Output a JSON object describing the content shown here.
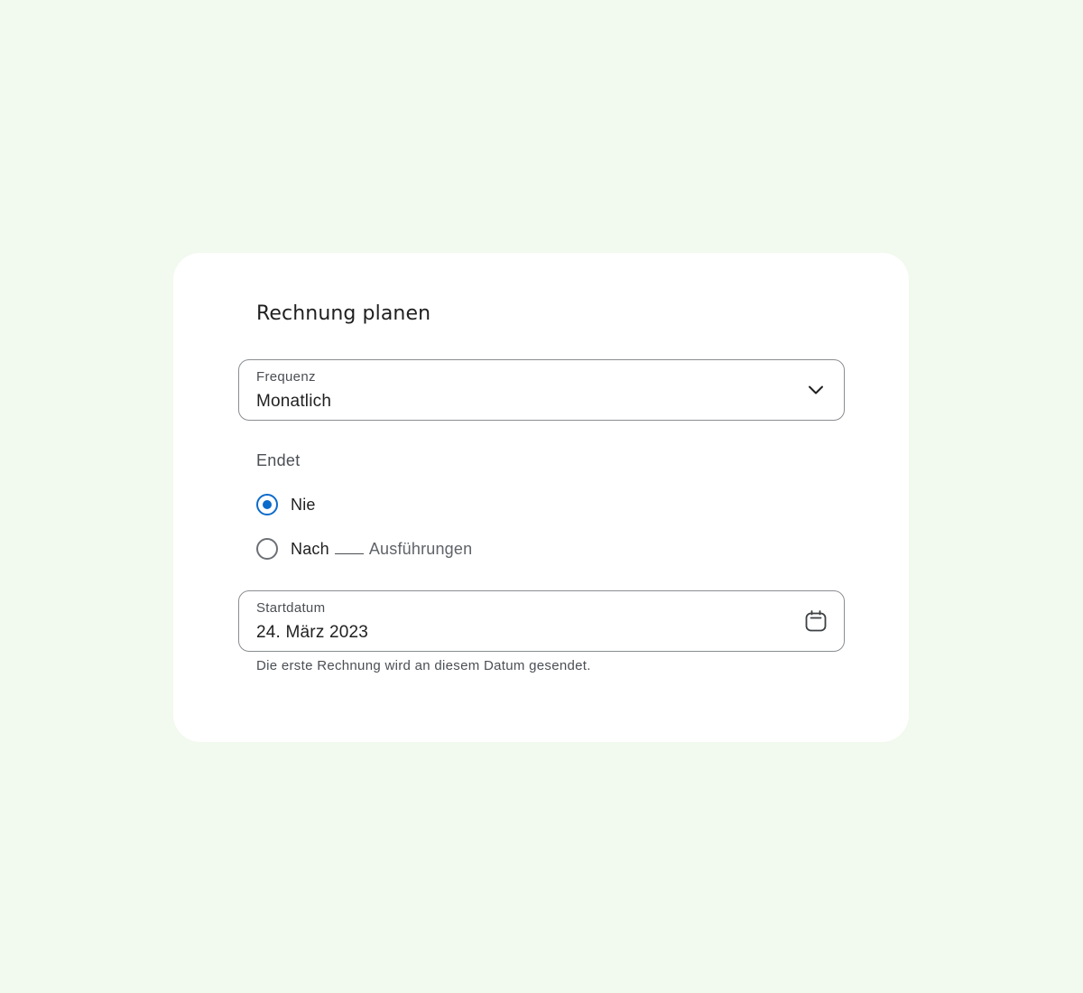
{
  "dialog": {
    "title": "Rechnung planen",
    "frequency": {
      "label": "Frequenz",
      "value": "Monatlich",
      "icon": "chevron-down-icon"
    },
    "ends": {
      "label": "Endet",
      "options": [
        {
          "label": "Nie",
          "selected": true
        },
        {
          "label_prefix": "Nach",
          "label_suffix": "Ausführungen",
          "selected": false
        }
      ]
    },
    "start_date": {
      "label": "Startdatum",
      "value": "24. März 2023",
      "icon": "calendar-icon",
      "helper": "Die erste Rechnung wird an diesem Datum gesendet."
    }
  },
  "colors": {
    "background": "#f2f9ee",
    "card": "#ffffff",
    "accent": "#0b6bcb",
    "outline": "#8a8d91"
  }
}
